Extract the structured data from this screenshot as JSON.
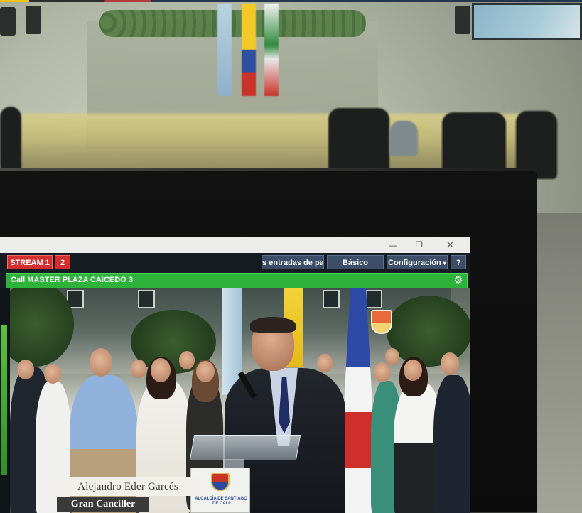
{
  "window": {
    "minimize_glyph": "—",
    "maximize_glyph": "❐",
    "close_glyph": "✕"
  },
  "toolbar": {
    "stream_1_label": "STREAM 1",
    "stream_2_label": "2",
    "entradas_label": "s entradas de pau",
    "basico_label": "Básico",
    "configuracion_label": "Configuración",
    "help_label": "?"
  },
  "call": {
    "title": "Call MASTER PLAZA CAICEDO 3",
    "settings_icon": "gear-icon"
  },
  "video": {
    "lower_third_name": "Alejandro Eder Garcés",
    "lower_third_role": "Gran Canciller",
    "sign_text": "ALCALDÍA DE SANTIAGO DE CALI"
  },
  "colors": {
    "stream_red": "#d42e2e",
    "toolbar_blue": "#3c4e68",
    "call_green": "#2eb33a"
  }
}
